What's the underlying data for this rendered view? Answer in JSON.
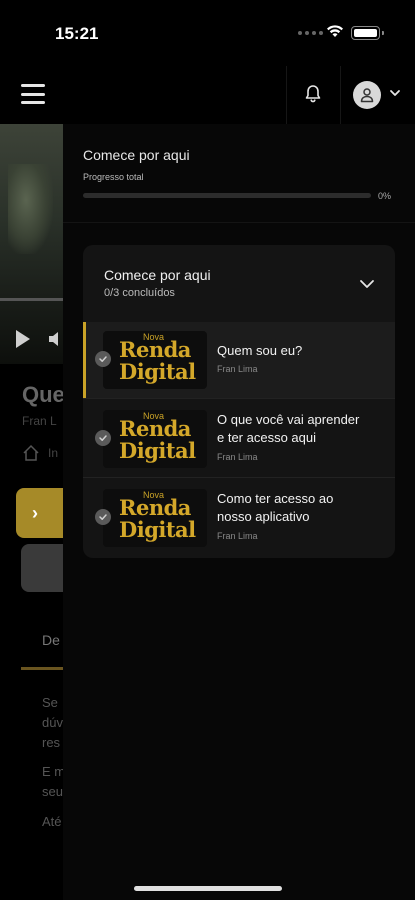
{
  "status_bar": {
    "time": "15:21"
  },
  "header": {
    "menu_icon": "hamburger-icon",
    "notification_icon": "bell-icon",
    "profile_icon": "user-icon"
  },
  "background": {
    "title_partial": "Que",
    "author_partial": "Fran L",
    "breadcrumb_partial": "In",
    "tab_partial": "De",
    "text_lines": [
      "Se",
      "dúv",
      "res",
      "E m",
      "seu",
      "Até"
    ]
  },
  "drawer": {
    "title": "Comece por aqui",
    "progress_label": "Progresso total",
    "progress_value": 0,
    "progress_text": "0%",
    "module": {
      "title": "Comece por aqui",
      "count_text": "0/3 concluídos",
      "lessons": [
        {
          "title_line1": "Quem sou eu?",
          "title_line2": "",
          "author": "Fran Lima",
          "thumb_small": "Nova",
          "thumb_line1": "Renda",
          "thumb_line2": "Digital",
          "active": true
        },
        {
          "title_line1": "O que você vai aprender",
          "title_line2": "e ter acesso aqui",
          "author": "Fran Lima",
          "thumb_small": "Nova",
          "thumb_line1": "Renda",
          "thumb_line2": "Digital",
          "active": false
        },
        {
          "title_line1": "Como ter acesso ao",
          "title_line2": "nosso aplicativo",
          "author": "Fran Lima",
          "thumb_small": "Nova",
          "thumb_line1": "Renda",
          "thumb_line2": "Digital",
          "active": false
        }
      ]
    }
  },
  "colors": {
    "accent": "#c9a227",
    "background": "#000000",
    "drawer": "#070707",
    "card": "#141414"
  }
}
